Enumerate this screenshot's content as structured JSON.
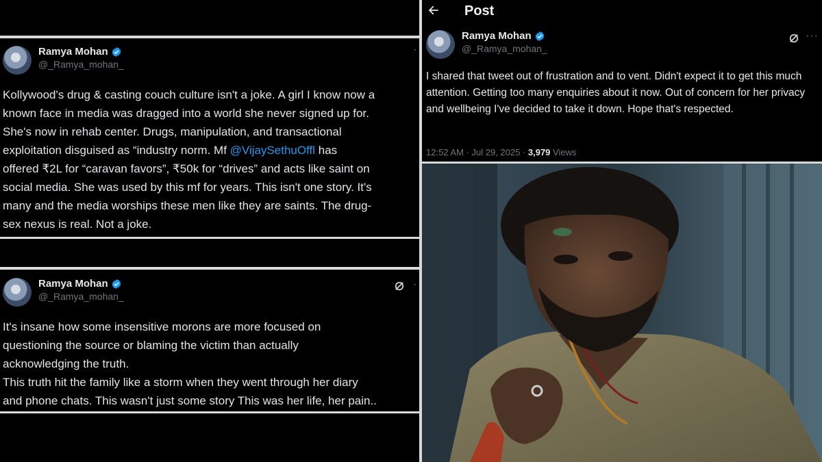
{
  "left_tweet_1": {
    "display_name": "Ramya Mohan",
    "handle": "@_Ramya_mohan_",
    "text_before": "Kollywood's drug & casting couch culture isn't a joke. A girl I know now a\nknown face in media was dragged into a world she never signed up for.\nShe's now in  rehab center. Drugs, manipulation, and transactional\nexploitation disguised as “industry norm. Mf ",
    "mention": "@VijaySethuOffl",
    "text_after": " has\noffered ₹2L for “caravan favors”, ₹50k for “drives” and acts like saint on\nsocial media. She was used by this mf for years. This isn't one story. It's\nmany and the media worships these men like they are saints. The drug-\nsex nexus is real. Not a joke."
  },
  "left_tweet_2": {
    "display_name": "Ramya Mohan",
    "handle": "@_Ramya_mohan_",
    "text": "It's insane how some insensitive morons are more focused on\nquestioning the source or blaming the victim than actually\nacknowledging the truth.\nThis truth hit the family like a storm when they went through her diary\nand phone chats. This wasn't just some story This was her life, her pain.."
  },
  "right_post": {
    "header_title": "Post",
    "display_name": "Ramya Mohan",
    "handle": "@_Ramya_mohan_",
    "text": "I shared that tweet out of frustration and to vent. Didn't expect it to get this much attention. Getting too many enquiries about it now. Out of concern for her privacy and wellbeing I've decided to take it down. Hope that's respected.",
    "timestamp": "12:52 AM · Jul 29, 2025 · ",
    "views_count": "3,979",
    "views_label": " Views"
  },
  "icons": {
    "verified": "verified-badge-icon",
    "grok": "grok-icon",
    "back": "back-arrow-icon",
    "more": "more-options-icon"
  },
  "colors": {
    "background": "#000000",
    "mention": "#1d9bf0",
    "verified": "#1d9bf0",
    "secondary_text": "#71767b"
  }
}
